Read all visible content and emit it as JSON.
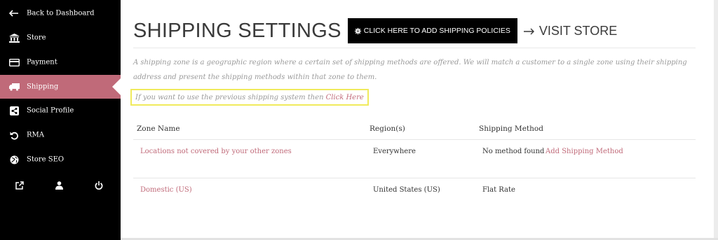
{
  "sidebar": {
    "items": [
      {
        "label": "Back to Dashboard",
        "icon": "back-arrow-icon",
        "active": false
      },
      {
        "label": "Store",
        "icon": "bank-icon",
        "active": false
      },
      {
        "label": "Payment",
        "icon": "credit-card-icon",
        "active": false
      },
      {
        "label": "Shipping",
        "icon": "truck-icon",
        "active": true
      },
      {
        "label": "Social Profile",
        "icon": "share-icon",
        "active": false
      },
      {
        "label": "RMA",
        "icon": "undo-icon",
        "active": false
      },
      {
        "label": "Store SEO",
        "icon": "globe-icon",
        "active": false
      }
    ],
    "bottom_icons": [
      "external-link-icon",
      "user-icon",
      "power-icon"
    ],
    "active_color": "#c06a79"
  },
  "header": {
    "title": "SHIPPING SETTINGS",
    "policy_button_label": "CLICK HERE TO ADD SHIPPING POLICIES",
    "visit_store_label": "VISIT STORE"
  },
  "description": "A shipping zone is a geographic region where a certain set of shipping methods are offered. We will match a customer to a single zone using their shipping address and present the shipping methods within that zone to them.",
  "notice": {
    "text": "If you want to use the previous shipping system then",
    "link_label": "Click Here"
  },
  "table": {
    "headers": [
      "Zone Name",
      "Region(s)",
      "Shipping Method"
    ],
    "rows": [
      {
        "zone": "Locations not covered by your other zones",
        "region": "Everywhere",
        "method": "No method found",
        "method_link": "Add Shipping Method"
      },
      {
        "zone": "Domestic (US)",
        "region": "United States (US)",
        "method": "Flat Rate",
        "method_link": ""
      }
    ]
  }
}
